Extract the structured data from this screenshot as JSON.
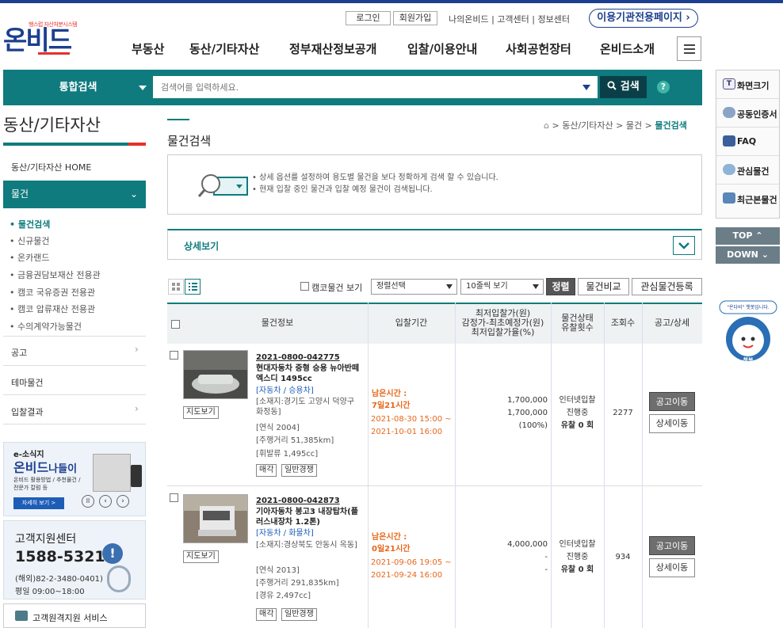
{
  "util": {
    "login": "로그인",
    "join": "회원가입",
    "links": "나의온비드 | 고객센터 | 정보센터",
    "partner_page": "이용기관전용페이지"
  },
  "logo": {
    "tagline": "행스럽 자산처분시스템",
    "name": "온비드"
  },
  "nav": [
    "부동산",
    "동산/기타자산",
    "정부재산정보공개",
    "입찰/이용안내",
    "사회공헌장터",
    "온비드소개"
  ],
  "search": {
    "category": "통합검색",
    "placeholder": "검색어를 입력하세요.",
    "button": "검색",
    "help": "?"
  },
  "quick": [
    "화면크기",
    "공동인증서",
    "FAQ",
    "관심물건",
    "최근본물건"
  ],
  "top_label": "TOP",
  "down_label": "DOWN",
  "chatbot_label": "\"온다비\" 챗봇입니다.",
  "chatbot_caption": "챗봇",
  "sidebar": {
    "title": "동산/기타자산",
    "home": "동산/기타자산 HOME",
    "active_menu": "물건",
    "sub_items": [
      "물건검색",
      "신규물건",
      "온카랜드",
      "금융권담보재산 전용관",
      "캠코 국유증권 전용관",
      "캠코 압류재산 전용관",
      "수의계약가능물건"
    ],
    "menus": [
      "공고",
      "테마물건",
      "입찰결과"
    ],
    "promo": {
      "kicker": "e-소식지",
      "title1": "온비드",
      "title2": "나들이",
      "desc": "온비드 활용방법 / 추천물건 / 전문가 칼럼 등",
      "more": "자세히 보기 >"
    },
    "cs": {
      "title": "고객지원센터",
      "phone": "1588-5321",
      "overseas": "(해외)82-2-3480-0401)",
      "hours": "평일 09:00~18:00"
    },
    "remote": "고객원격지원 서비스"
  },
  "breadcrumb": {
    "items": [
      "동산/기타자산",
      "물건"
    ],
    "current": "물건검색"
  },
  "page_title": "물건검색",
  "guide": [
    "• 상세 옵션를 설정하여 용도별 물건을 보다 정확하게 검색 할 수 있습니다.",
    "• 현재 입찰 중인 물건과 입찰 예정 물건이 검색됩니다."
  ],
  "detail_view": "상세보기",
  "toolbar": {
    "camco_view": "캠코물건 보기",
    "sort_select": "정렬선택",
    "per_page": "10줄씩 보기",
    "sort_btn": "정렬",
    "compare_btn": "물건비교",
    "fav_btn": "관심물건등록"
  },
  "table": {
    "headers": {
      "info": "물건정보",
      "period": "입찰기간",
      "price1": "최저입찰가(원)",
      "price2": "감정가-최초예정가(원)",
      "price3": "최저입찰가율(%)",
      "status1": "물건상태",
      "status2": "유찰횟수",
      "views": "조회수",
      "notice": "공고/상세"
    },
    "rows": [
      {
        "id": "2021-0800-042775",
        "title": "현대자동차 중형 승용 뉴아반떼엑스디 1495cc",
        "category": "[자동차 / 승용차]",
        "location": "[소재지:경기도 고양시 덕양구 화정동]",
        "year": "[연식 2004]",
        "mileage": "[주행거리 51,385km]",
        "fuel": "[휘발류 1,495cc]",
        "tag1": "매각",
        "tag2": "일반경쟁",
        "map": "지도보기",
        "remain_label": "남은시간 :",
        "remain": "7일21시간",
        "start": "2021-08-30 15:00 ~",
        "end": "2021-10-01 16:00",
        "min_price": "1,700,000",
        "appraisal": "1,700,000",
        "rate": "(100%)",
        "bid_type": "인터넷입찰",
        "status": "진행중",
        "fail": "유찰 0 회",
        "views": "2277",
        "notice_btn": "공고이동",
        "detail_btn": "상세이동"
      },
      {
        "id": "2021-0800-042873",
        "title": "기아자동차 봉고3 내장탑차(플러스내장차 1.2톤)",
        "category": "[자동차 / 화물차]",
        "location": "[소재지:경상북도 안동시 옥동]",
        "year": "[연식 2013]",
        "mileage": "[주행거리 291,835km]",
        "fuel": "[경유 2,497cc]",
        "tag1": "매각",
        "tag2": "일반경쟁",
        "map": "지도보기",
        "remain_label": "남은시간 :",
        "remain": "0일21시간",
        "start": "2021-09-06 19:05 ~",
        "end": "2021-09-24 16:00",
        "min_price": "4,000,000",
        "appraisal": "-",
        "rate": "-",
        "bid_type": "인터넷입찰",
        "status": "진행중",
        "fail": "유찰 0 회",
        "views": "934",
        "notice_btn": "공고이동",
        "detail_btn": "상세이동"
      }
    ]
  },
  "colors": {
    "teal": "#0f7b7e",
    "navy": "#1d3f8f",
    "red": "#e4322b",
    "orange": "#e8661a"
  }
}
